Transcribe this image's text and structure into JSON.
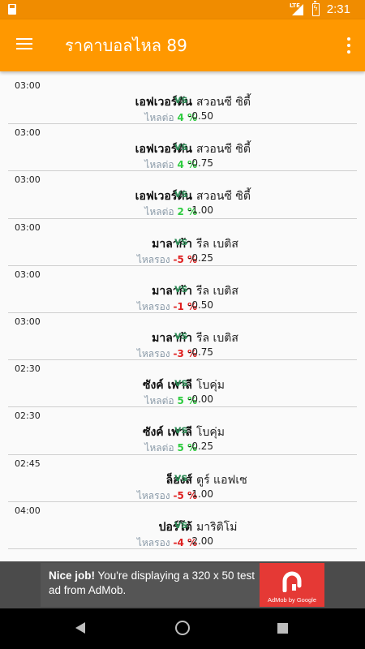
{
  "status_bar": {
    "time": "2:31",
    "network": "LTE",
    "icons": [
      "sd-card-icon",
      "signal-icon",
      "battery-charging-icon"
    ]
  },
  "app_bar": {
    "title": "ราคาบอลไหล 89",
    "menu_icon": "hamburger-menu-icon",
    "overflow_icon": "more-vert-icon",
    "color": "#ff9800"
  },
  "colors": {
    "vs": "#2e8b57",
    "flow_label": "#8a9aa8",
    "positive": "#2ecc40",
    "negative": "#e02020"
  },
  "matches": [
    {
      "time": "03:00",
      "home": "เอฟเวอร์ตัน",
      "vs": "vs",
      "away": "สวอนซี ซิตี้",
      "flow_label": "ไหลต่อ",
      "flow_pct": "4 %",
      "trend": "up",
      "odds": "-0.50"
    },
    {
      "time": "03:00",
      "home": "เอฟเวอร์ตัน",
      "vs": "vs",
      "away": "สวอนซี ซิตี้",
      "flow_label": "ไหลต่อ",
      "flow_pct": "4 %",
      "trend": "up",
      "odds": "-0.75"
    },
    {
      "time": "03:00",
      "home": "เอฟเวอร์ตัน",
      "vs": "vs",
      "away": "สวอนซี ซิตี้",
      "flow_label": "ไหลต่อ",
      "flow_pct": "2 %",
      "trend": "up",
      "odds": "-1.00"
    },
    {
      "time": "03:00",
      "home": "มาลาก้า",
      "vs": "vs",
      "away": "รีล เบติส",
      "flow_label": "ไหลรอง",
      "flow_pct": "-5 %",
      "trend": "down",
      "odds": "-0.25"
    },
    {
      "time": "03:00",
      "home": "มาลาก้า",
      "vs": "vs",
      "away": "รีล เบติส",
      "flow_label": "ไหลรอง",
      "flow_pct": "-1 %",
      "trend": "down",
      "odds": "-0.50"
    },
    {
      "time": "03:00",
      "home": "มาลาก้า",
      "vs": "vs",
      "away": "รีล เบติส",
      "flow_label": "ไหลรอง",
      "flow_pct": "-3 %",
      "trend": "down",
      "odds": "-0.75"
    },
    {
      "time": "02:30",
      "home": "ซังค์ เพาลี",
      "vs": "vs",
      "away": "โบคุ่ม",
      "flow_label": "ไหลต่อ",
      "flow_pct": "5 %",
      "trend": "up",
      "odds": "-0.00"
    },
    {
      "time": "02:30",
      "home": "ซังค์ เพาลี",
      "vs": "vs",
      "away": "โบคุ่ม",
      "flow_label": "ไหลต่อ",
      "flow_pct": "5 %",
      "trend": "up",
      "odds": "-0.25"
    },
    {
      "time": "02:45",
      "home": "ล็องส์",
      "vs": "vs",
      "away": "ตูร์ แอฟเซ",
      "flow_label": "ไหลรอง",
      "flow_pct": "-5 %",
      "trend": "down",
      "odds": "-1.00"
    },
    {
      "time": "04:00",
      "home": "ปอร์โต้",
      "vs": "vs",
      "away": "มาริติโม่",
      "flow_label": "ไหลรอง",
      "flow_pct": "-4 %",
      "trend": "down",
      "odds": "-2.00"
    }
  ],
  "ad": {
    "headline": "Nice job!",
    "body": " You're displaying a 320 x 50 test ad from AdMob.",
    "brand": "AdMob by Google",
    "logo_icon": "admob-logo-icon"
  },
  "nav_bar": {
    "icons": [
      "back-icon",
      "home-icon",
      "recents-icon"
    ]
  }
}
